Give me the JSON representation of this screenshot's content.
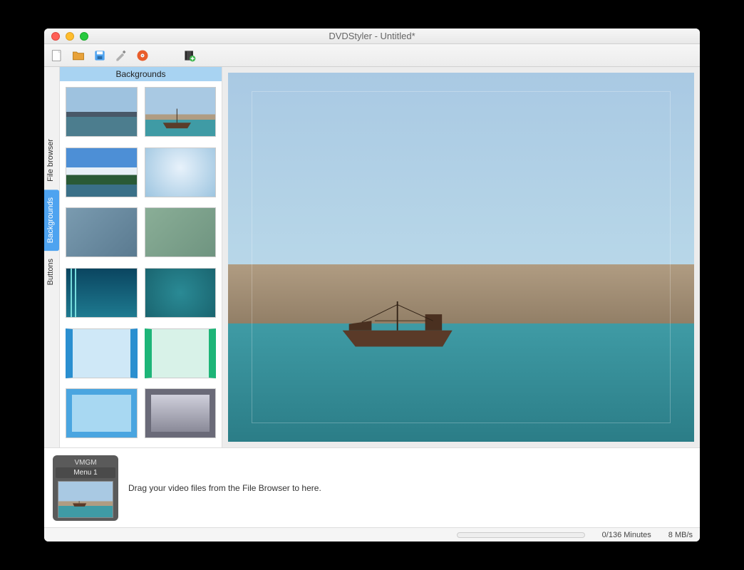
{
  "window": {
    "title": "DVDStyler - Untitled*"
  },
  "toolbar": {
    "icons": [
      "new-project",
      "open-folder",
      "save",
      "settings",
      "burn-disc",
      "add-title"
    ]
  },
  "sidebar": {
    "tabs": [
      {
        "id": "file-browser",
        "label": "File browser",
        "active": false
      },
      {
        "id": "backgrounds",
        "label": "Backgrounds",
        "active": true
      },
      {
        "id": "buttons",
        "label": "Buttons",
        "active": false
      }
    ],
    "panel_title": "Backgrounds",
    "thumbnails": [
      {
        "id": "bg-sea-rocks",
        "type": "photo"
      },
      {
        "id": "bg-shipwreck",
        "type": "photo"
      },
      {
        "id": "bg-coast-sky",
        "type": "photo"
      },
      {
        "id": "bg-pale-blue-grad",
        "type": "gradient"
      },
      {
        "id": "bg-blue-blur",
        "type": "texture"
      },
      {
        "id": "bg-green-blur",
        "type": "texture"
      },
      {
        "id": "bg-teal-lines",
        "type": "pattern"
      },
      {
        "id": "bg-teal-grain",
        "type": "texture"
      },
      {
        "id": "bg-blue-frame",
        "type": "pattern"
      },
      {
        "id": "bg-green-frame",
        "type": "pattern"
      },
      {
        "id": "bg-sky-square",
        "type": "pattern"
      },
      {
        "id": "bg-gray-square",
        "type": "pattern"
      }
    ]
  },
  "canvas": {
    "background_id": "bg-shipwreck"
  },
  "timeline": {
    "group_label": "VMGM",
    "menu_label": "Menu 1",
    "hint": "Drag your video files from the File Browser to here."
  },
  "status": {
    "duration": "0/136 Minutes",
    "bitrate": "8 MB/s"
  }
}
